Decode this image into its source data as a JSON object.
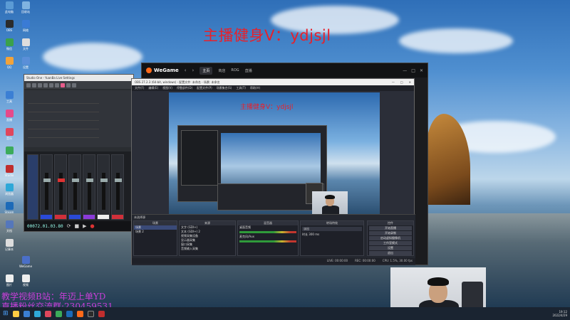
{
  "overlay": {
    "title": "主播健身V：ydjsjl",
    "line1": "教学视频B站：年迈上单YD",
    "line2": "直播粉丝交流群:230459531"
  },
  "studio": {
    "title": "Studio One - YuanBa Live Settings",
    "time": "00072.01.03.80"
  },
  "wegame": {
    "brand": "WeGame",
    "nav": [
      "主页",
      "商店",
      "ROG",
      "直播"
    ]
  },
  "obs": {
    "title": "OBS 27.2.3 (64-bit, windows) - 配置文件: 未命名 - 场景: 未命名",
    "menus": [
      "文件(F)",
      "编辑(E)",
      "视图(V)",
      "停靠部件(D)",
      "配置文件(P)",
      "场景集合(S)",
      "工具(T)",
      "帮助(H)"
    ],
    "preview_overlay": "主播健身V：ydjsjl",
    "dock_title": "未选择源",
    "docks": {
      "scenes": "场景",
      "sources": "来源",
      "mixer": "混音器",
      "transitions": "转场特效",
      "controls": "控件"
    },
    "scenes": [
      "场景",
      "场景 2"
    ],
    "sources": [
      "文字 (GDI+)",
      "文本 (GDI+) 2",
      "视频采集设备",
      "显示器采集",
      "窗口采集",
      "音频输入采集"
    ],
    "mixer_tracks": [
      "桌面音频",
      "麦克风/Aux"
    ],
    "transition": "淡出",
    "duration_label": "时长",
    "duration": "300 ms",
    "controls": [
      "开始直播",
      "开始录制",
      "启动虚拟摄像机",
      "工作室模式",
      "设置",
      "退出"
    ],
    "status": [
      "LIVE: 00:00:00",
      "REC: 00:00:00",
      "CPU: 1.5%, 30.00 fps"
    ]
  },
  "taskbar": {
    "time": "19:12",
    "date": "2022/4/29"
  },
  "colors": {
    "overlay_red": "#e8202a",
    "overlay_magenta": "#c83fd8",
    "wegame_orange": "#ff6a1a"
  }
}
